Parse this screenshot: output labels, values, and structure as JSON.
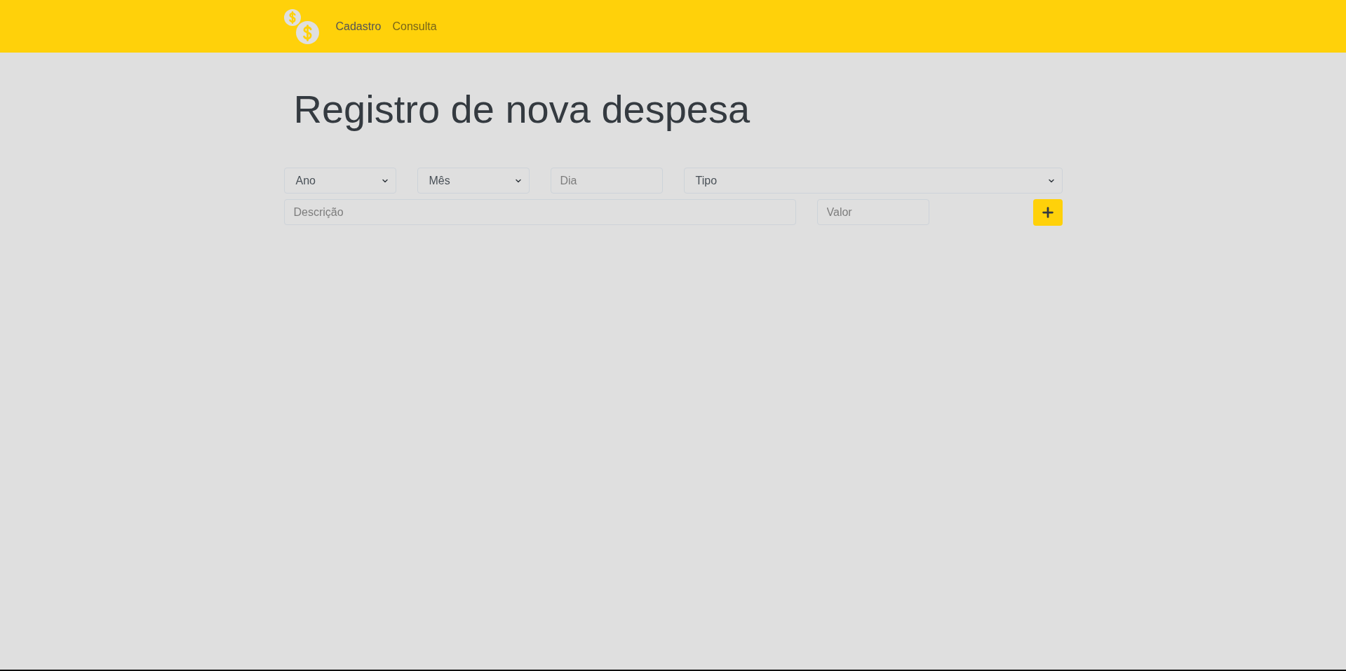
{
  "navbar": {
    "links": [
      {
        "label": "Cadastro",
        "selected": true
      },
      {
        "label": "Consulta",
        "selected": false
      }
    ]
  },
  "title": "Registro de nova despesa",
  "form": {
    "rows": [
      {
        "fields": [
          {
            "kind": "select",
            "value": "Ano"
          },
          {
            "kind": "select",
            "value": "Mês"
          },
          {
            "kind": "input",
            "placeholder": "Dia"
          },
          {
            "kind": "select",
            "value": "Tipo"
          }
        ]
      },
      {
        "fields": [
          {
            "kind": "input",
            "placeholder": "Descrição"
          },
          {
            "kind": "input",
            "placeholder": "Valor"
          },
          {
            "kind": "button"
          }
        ]
      }
    ]
  }
}
